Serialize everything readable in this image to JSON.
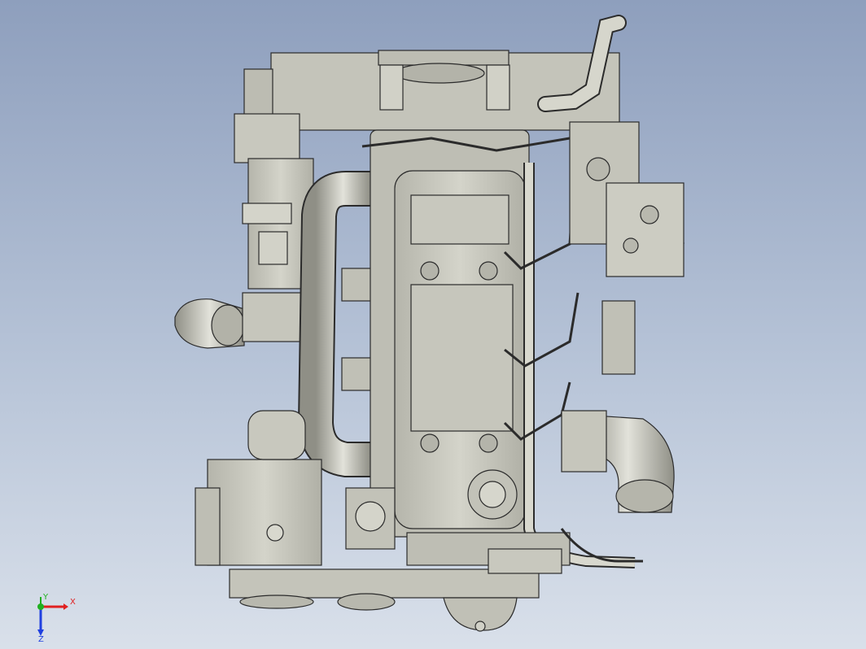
{
  "viewport": {
    "background_top": "#8e9fbd",
    "background_bottom": "#d9e0ea",
    "model_fill": "#c9c9bf",
    "model_shade": "#a9a99f",
    "model_edge": "#2b2b2b"
  },
  "triad": {
    "x_label": "X",
    "y_label": "Y",
    "z_label": "Z",
    "x_color": "#e02020",
    "y_color": "#20b020",
    "z_color": "#2040e0"
  }
}
